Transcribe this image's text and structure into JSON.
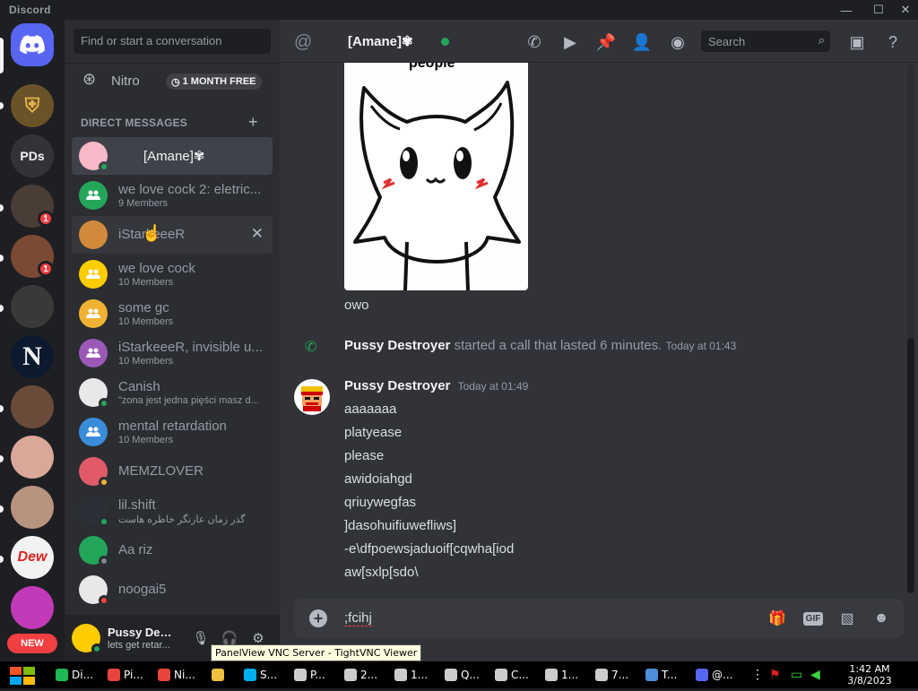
{
  "window": {
    "app_name": "Discord",
    "minimize": "—",
    "maximize": "☐",
    "close": "✕"
  },
  "guilds": [
    {
      "name": "discord-home",
      "label": "",
      "color": "#5865f2"
    },
    {
      "name": "server-shield",
      "label": "",
      "color": "#6b5328"
    },
    {
      "name": "server-pds",
      "label": "PDs",
      "color": "#313338"
    },
    {
      "name": "server-photo-1",
      "label": "",
      "color": "#4a3d36",
      "badge": "1"
    },
    {
      "name": "server-photo-2",
      "label": "",
      "color": "#7a4a35",
      "badge": "1"
    },
    {
      "name": "server-photo-3",
      "label": "",
      "color": "#3b3838"
    },
    {
      "name": "server-n",
      "label": "N",
      "color": "#0c1a2e"
    },
    {
      "name": "server-photo-4",
      "label": "",
      "color": "#6a4b3a"
    },
    {
      "name": "server-photo-5",
      "label": "",
      "color": "#d9a898"
    },
    {
      "name": "server-photo-6",
      "label": "",
      "color": "#b8937e"
    },
    {
      "name": "server-mtn-dew",
      "label": "Dew",
      "color": "#f2f2f2"
    },
    {
      "name": "server-kitten",
      "label": "",
      "color": "#c23ab8"
    }
  ],
  "new_badge": "NEW",
  "sidebar": {
    "search_placeholder": "Find or start a conversation",
    "nitro_label": "Nitro",
    "nitro_pill": "1 MONTH FREE",
    "dm_header": "DIRECT MESSAGES",
    "dm_add": "+",
    "dms": [
      {
        "name": "[Amane]✾",
        "sub": "",
        "active": true,
        "avatar_color": "#f7b8c8",
        "status": "online"
      },
      {
        "name": "we love cock 2: eletric...",
        "sub": "9 Members",
        "avatar_color": "#23a55a",
        "group": true
      },
      {
        "name": "iStarkeeeR",
        "sub": "",
        "hover": true,
        "avatar_color": "#d08a3a",
        "close": "✕"
      },
      {
        "name": "we love cock",
        "sub": "10 Members",
        "avatar_color": "#ffcc00",
        "group": true
      },
      {
        "name": "some gc",
        "sub": "10 Members",
        "avatar_color": "#f0b232",
        "group": true
      },
      {
        "name": "iStarkeeeR, invisible u...",
        "sub": "10 Members",
        "avatar_color": "#9b59b6",
        "group": true
      },
      {
        "name": "Canish",
        "sub": "\"zona jest jedna pięści masz d...",
        "avatar_color": "#e8e8e8",
        "status": "online"
      },
      {
        "name": "mental retardation",
        "sub": "10 Members",
        "avatar_color": "#3b8bdb",
        "group": true
      },
      {
        "name": "MEMZLOVER",
        "sub": "",
        "avatar_color": "#e05a6a",
        "status": "idle"
      },
      {
        "name": "lil.shift",
        "sub": "گذر زمان عازنگر خاطره هاست",
        "avatar_color": "#2a3036",
        "status": "online"
      },
      {
        "name": "Aa riz",
        "sub": "",
        "avatar_color": "#23a55a",
        "status": "offline"
      },
      {
        "name": "noogai5",
        "sub": "",
        "avatar_color": "#e8e8e8",
        "status": "dnd"
      }
    ]
  },
  "user_panel": {
    "name": "Pussy Des...",
    "status": "lets get retar...",
    "mic_icon": "mic-icon",
    "headphones_icon": "headphones-icon",
    "settings_icon": "gear-icon"
  },
  "topbar": {
    "channel_title": "[Amane]✾",
    "search_placeholder": "Search"
  },
  "messages": {
    "image_top_text": "people",
    "image_caption": "owo",
    "call": {
      "author": "Pussy Destroyer",
      "text": "started a call that lasted 6 minutes.",
      "timestamp": "Today at 01:43"
    },
    "group": {
      "author": "Pussy Destroyer",
      "timestamp": "Today at 01:49",
      "lines": [
        "aaaaaaa",
        "platyease",
        "please",
        "awidoiahgd",
        "qriuywegfas",
        "]dasohuifiuwefliws]",
        "-e\\dfpoewsjaduoif[cqwha[iod",
        "aw[sxlp[sdo\\"
      ]
    }
  },
  "composer": {
    "text": ";fcihj",
    "gif_label": "GIF"
  },
  "tooltip": "PanelView VNC Server - TightVNC Viewer",
  "taskbar": {
    "items": [
      {
        "label": "Di...",
        "color": "#1db954"
      },
      {
        "label": "Pi...",
        "color": "#e8453c"
      },
      {
        "label": "Ni...",
        "color": "#e8453c"
      },
      {
        "label": "",
        "color": "#f0c040"
      },
      {
        "label": "S...",
        "color": "#00aff0"
      },
      {
        "label": "P...",
        "color": "#cccccc"
      },
      {
        "label": "2...",
        "color": "#cccccc"
      },
      {
        "label": "1...",
        "color": "#cccccc"
      },
      {
        "label": "Q...",
        "color": "#cccccc"
      },
      {
        "label": "C...",
        "color": "#cccccc"
      },
      {
        "label": "1...",
        "color": "#cccccc"
      },
      {
        "label": "7...",
        "color": "#cccccc"
      },
      {
        "label": "T...",
        "color": "#4a90d9"
      },
      {
        "label": "@...",
        "color": "#5865f2"
      }
    ],
    "clock_time": "1:42 AM",
    "clock_date": "3/8/2023"
  },
  "colors": {
    "accent": "#5865f2",
    "online": "#23a55a",
    "danger": "#f23f42",
    "idle": "#f0b232"
  }
}
